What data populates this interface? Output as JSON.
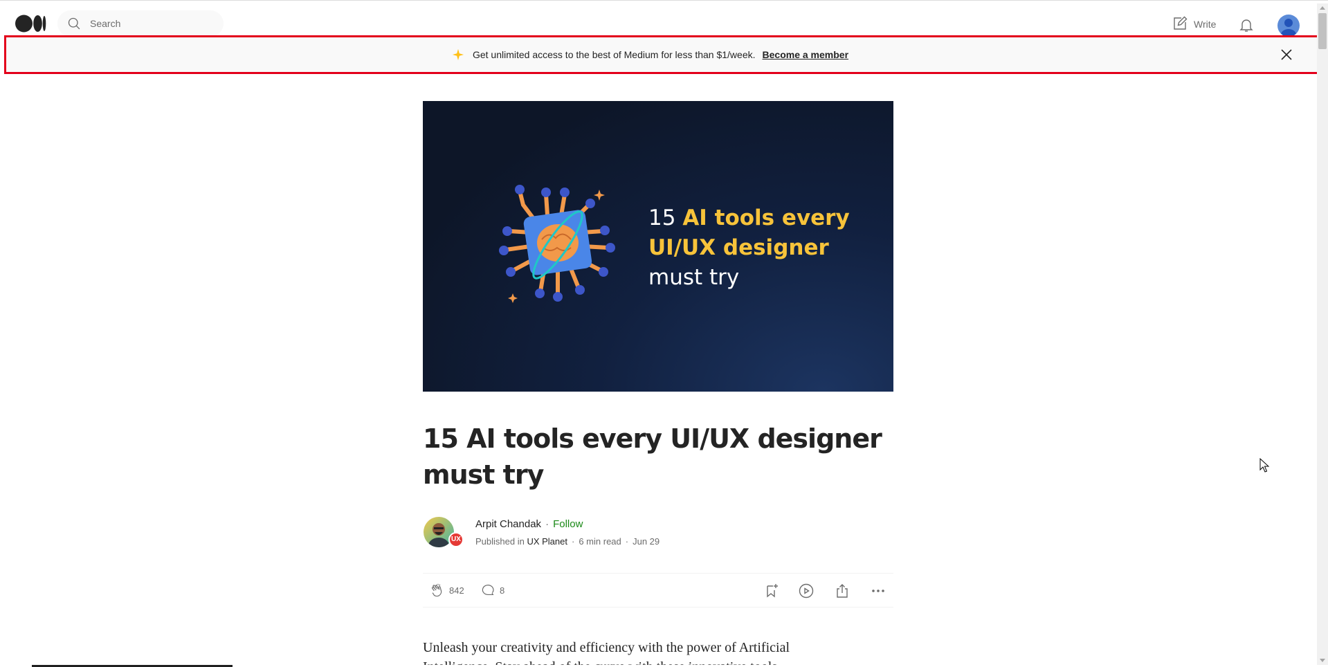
{
  "nav": {
    "search_placeholder": "Search",
    "write_label": "Write"
  },
  "banner": {
    "text": "Get unlimited access to the best of Medium for less than $1/week.",
    "link": "Become a member",
    "accent_color": "#e3001b"
  },
  "hero": {
    "line1_num": "15",
    "line1_rest": "AI tools every",
    "line2": "UI/UX designer",
    "line3": "must try"
  },
  "article": {
    "title": "15 AI tools every UI/UX designer must try",
    "author": "Arpit Chandak",
    "follow_label": "Follow",
    "published_prefix": "Published in",
    "publication": "UX Planet",
    "read_time": "6 min read",
    "date": "Jun 29",
    "publication_badge": "UX",
    "claps": "842",
    "comments": "8",
    "body_first_line": "Unleash your creativity and efficiency with the power of Artificial",
    "body_second_line": "Intelligence. Stay ahead of the curve with these innovative tools"
  },
  "icons": {
    "logo": "medium-logo-icon",
    "search": "search-icon",
    "write": "write-icon",
    "bell": "bell-icon",
    "close": "close-icon",
    "clap": "clap-icon",
    "comment": "comment-icon",
    "bookmark": "bookmark-icon",
    "play": "play-icon",
    "share": "share-icon",
    "more": "more-icon"
  }
}
